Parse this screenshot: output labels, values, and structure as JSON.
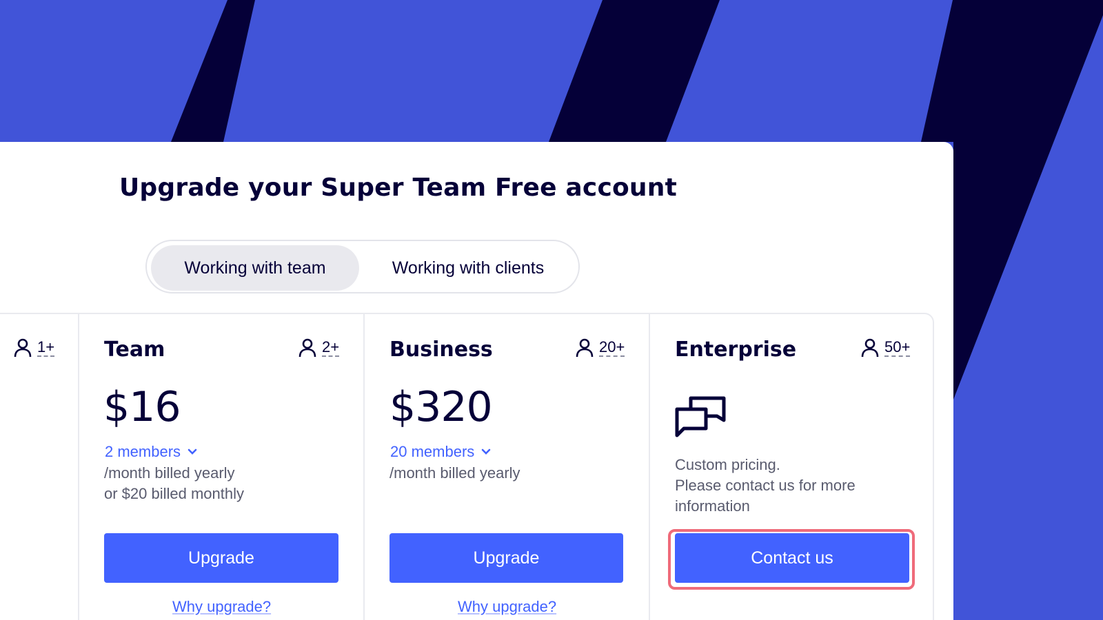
{
  "page": {
    "heading": "Upgrade your Super Team Free account"
  },
  "toggle": {
    "options": [
      "Working with team",
      "Working with clients"
    ],
    "selected": "Working with team"
  },
  "plans": [
    {
      "name": "",
      "seats": "1+"
    },
    {
      "name": "Team",
      "seats": "2+",
      "price": "$16",
      "members": "2 members",
      "billing_line1": "/month billed yearly",
      "billing_line2": "or $20 billed monthly",
      "button": "Upgrade",
      "link": "Why upgrade?"
    },
    {
      "name": "Business",
      "seats": "20+",
      "price": "$320",
      "members": "20 members",
      "billing_line1": "/month billed yearly",
      "button": "Upgrade",
      "link": "Why upgrade?"
    },
    {
      "name": "Enterprise",
      "seats": "50+",
      "icon": "chat-bubbles-icon",
      "custom_line1": "Custom pricing.",
      "custom_line2": "Please contact us for more information",
      "button": "Contact us"
    }
  ],
  "colors": {
    "brand_blue": "#4154d8",
    "dark_navy": "#050038",
    "button_blue": "#4262ff",
    "highlight": "#ef6b7a"
  }
}
